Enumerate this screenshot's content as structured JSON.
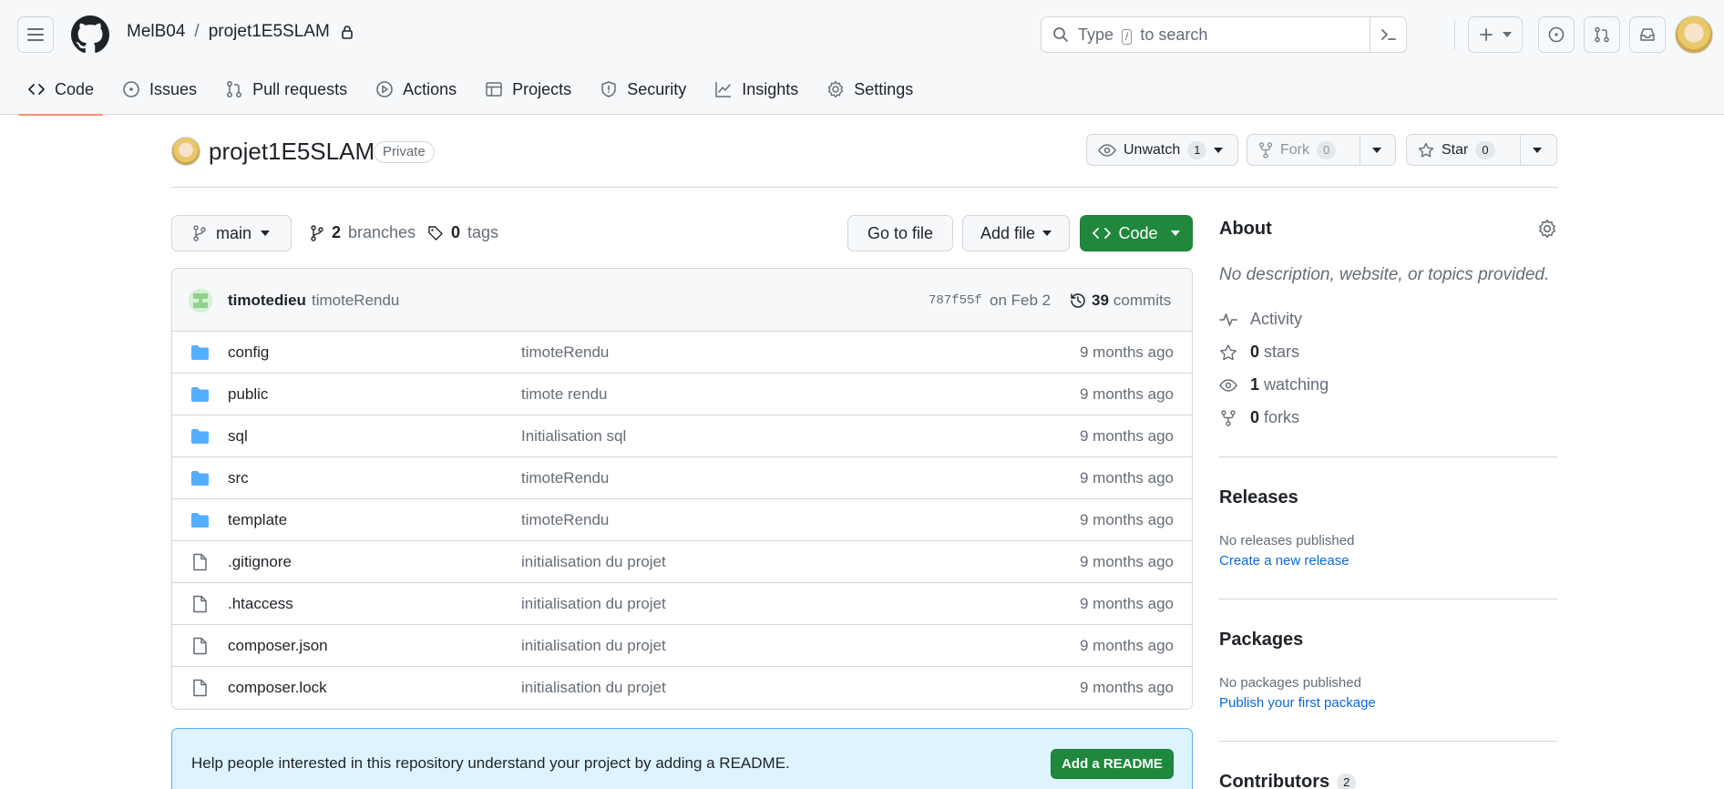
{
  "header": {
    "owner": "MelB04",
    "separator": "/",
    "repo": "projet1E5SLAM",
    "search_type": "Type",
    "search_key": "/",
    "search_suffix": "to search"
  },
  "tabs": [
    {
      "label": "Code",
      "icon": "code-icon"
    },
    {
      "label": "Issues",
      "icon": "issue-icon"
    },
    {
      "label": "Pull requests",
      "icon": "pull-request-icon"
    },
    {
      "label": "Actions",
      "icon": "play-icon"
    },
    {
      "label": "Projects",
      "icon": "table-icon"
    },
    {
      "label": "Security",
      "icon": "shield-icon"
    },
    {
      "label": "Insights",
      "icon": "graph-icon"
    },
    {
      "label": "Settings",
      "icon": "gear-icon"
    }
  ],
  "repo": {
    "title": "projet1E5SLAM",
    "visibility": "Private",
    "unwatch_label": "Unwatch",
    "watch_count": "1",
    "fork_label": "Fork",
    "fork_count": "0",
    "star_label": "Star",
    "star_count": "0"
  },
  "filenav": {
    "branch": "main",
    "branches_count": "2",
    "branches_label": "branches",
    "tags_count": "0",
    "tags_label": "tags",
    "goto_file": "Go to file",
    "add_file": "Add file",
    "code": "Code"
  },
  "commit": {
    "author": "timotedieu",
    "message": "timoteRendu",
    "sha": "787f55f",
    "date": "on Feb 2",
    "count": "39",
    "count_label": "commits"
  },
  "files": [
    {
      "name": "config",
      "type": "folder",
      "message": "timoteRendu",
      "age": "9 months ago"
    },
    {
      "name": "public",
      "type": "folder",
      "message": "timote rendu",
      "age": "9 months ago"
    },
    {
      "name": "sql",
      "type": "folder",
      "message": "Initialisation sql",
      "age": "9 months ago"
    },
    {
      "name": "src",
      "type": "folder",
      "message": "timoteRendu",
      "age": "9 months ago"
    },
    {
      "name": "template",
      "type": "folder",
      "message": "timoteRendu",
      "age": "9 months ago"
    },
    {
      "name": ".gitignore",
      "type": "file",
      "message": "initialisation du projet",
      "age": "9 months ago"
    },
    {
      "name": ".htaccess",
      "type": "file",
      "message": "initialisation du projet",
      "age": "9 months ago"
    },
    {
      "name": "composer.json",
      "type": "file",
      "message": "initialisation du projet",
      "age": "9 months ago"
    },
    {
      "name": "composer.lock",
      "type": "file",
      "message": "initialisation du projet",
      "age": "9 months ago"
    }
  ],
  "readme": {
    "text": "Help people interested in this repository understand your project by adding a README.",
    "button": "Add a README"
  },
  "about": {
    "title": "About",
    "description": "No description, website, or topics provided.",
    "activity": "Activity",
    "stars_count": "0",
    "stars_label": "stars",
    "watching_count": "1",
    "watching_label": "watching",
    "forks_count": "0",
    "forks_label": "forks"
  },
  "releases": {
    "title": "Releases",
    "empty": "No releases published",
    "link": "Create a new release"
  },
  "packages": {
    "title": "Packages",
    "empty": "No packages published",
    "link": "Publish your first package"
  },
  "contributors": {
    "title": "Contributors",
    "count": "2"
  },
  "colors": {
    "accent_green": "#1f883d",
    "link_blue": "#0969da",
    "folder_blue": "#54aeff",
    "tab_underline": "#fd8c73"
  }
}
